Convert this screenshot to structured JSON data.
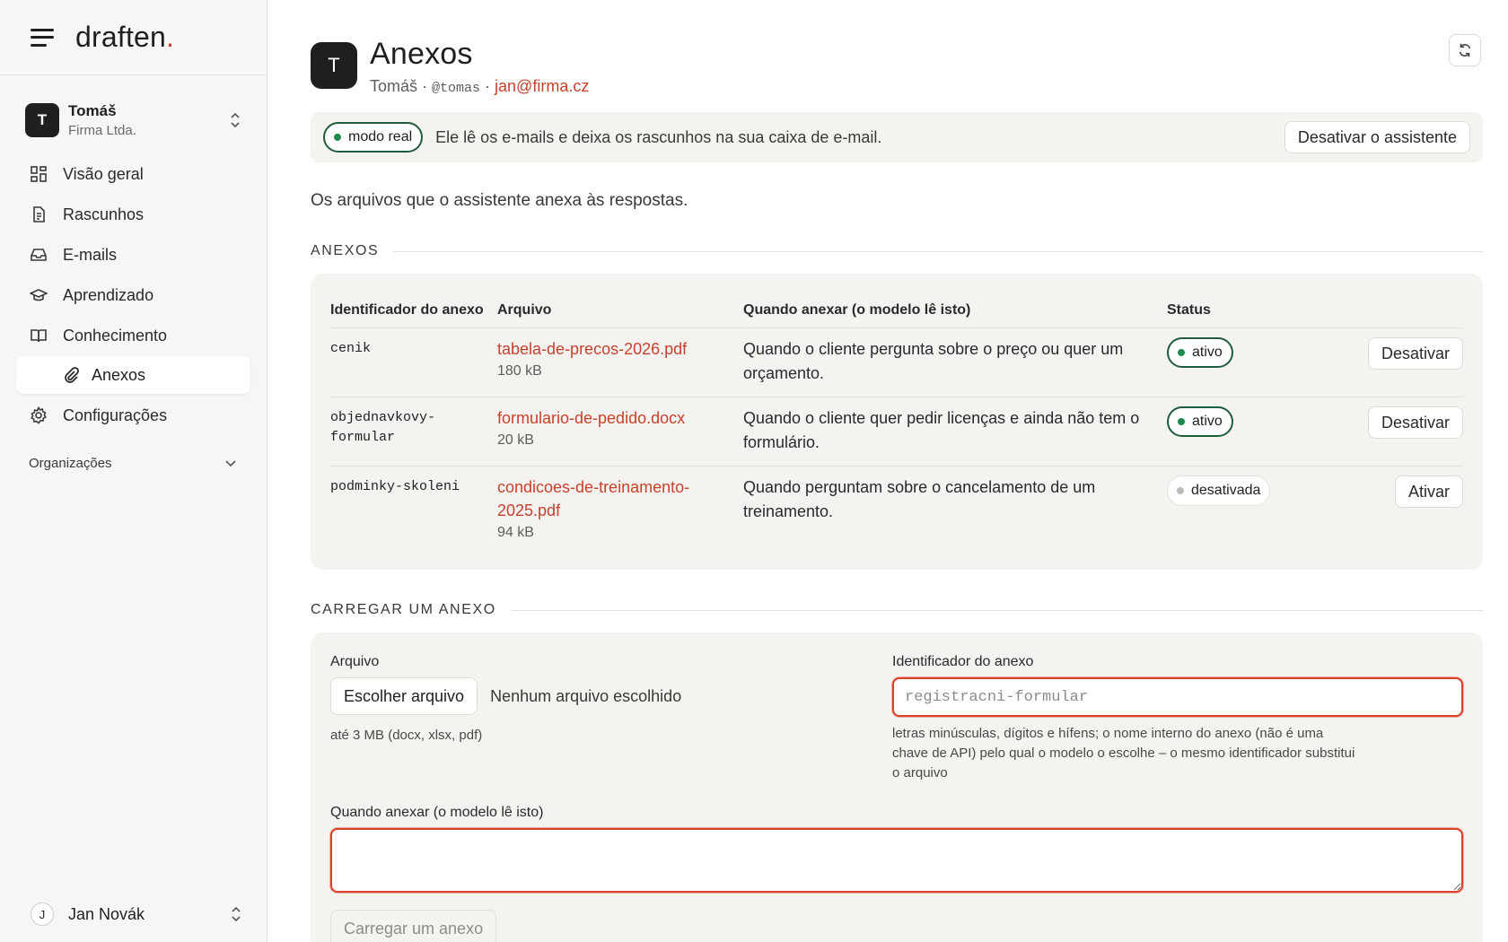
{
  "app": {
    "logo_text": "draften",
    "logo_dot": ".",
    "accent_color": "#c8412b"
  },
  "sidebar": {
    "account": {
      "initial": "T",
      "name": "Tomáš",
      "org": "Firma Ltda."
    },
    "items": [
      {
        "label": "Visão geral",
        "icon": "dashboard-icon"
      },
      {
        "label": "Rascunhos",
        "icon": "document-icon"
      },
      {
        "label": "E-mails",
        "icon": "inbox-icon"
      },
      {
        "label": "Aprendizado",
        "icon": "graduation-cap-icon"
      },
      {
        "label": "Conhecimento",
        "icon": "book-icon"
      }
    ],
    "sub_item": {
      "label": "Anexos",
      "icon": "paperclip-icon"
    },
    "settings": {
      "label": "Configurações",
      "icon": "gear-icon"
    },
    "organizations_label": "Organizações",
    "user": {
      "initial": "J",
      "name": "Jan Novák"
    }
  },
  "header": {
    "avatar_initial": "T",
    "title": "Anexos",
    "user_name": "Tomáš",
    "sep1": " · ",
    "handle": "@tomas",
    "sep2": " · ",
    "email": "jan@firma.cz"
  },
  "banner": {
    "mode_label": "modo real",
    "text": "Ele lê os e-mails e deixa os rascunhos na sua caixa de e-mail.",
    "deactivate_button": "Desativar o assistente"
  },
  "intro": "Os arquivos que o assistente anexa às respostas.",
  "attachments_section": {
    "label": "ANEXOS",
    "columns": [
      "Identificador do anexo",
      "Arquivo",
      "Quando anexar (o modelo lê isto)",
      "Status",
      ""
    ],
    "rows": [
      {
        "identifier": "cenik",
        "file": "tabela-de-precos-2026.pdf",
        "size": "180 kB",
        "when": "Quando o cliente pergunta sobre o preço ou quer um orçamento.",
        "status": "ativo",
        "action": "Desativar"
      },
      {
        "identifier": "objednavkovy-formular",
        "file": "formulario-de-pedido.docx",
        "size": "20 kB",
        "when": "Quando o cliente quer pedir licenças e ainda não tem o formulário.",
        "status": "ativo",
        "action": "Desativar"
      },
      {
        "identifier": "podminky-skoleni",
        "file": "condicoes-de-treinamento-2025.pdf",
        "size": "94 kB",
        "when": "Quando perguntam sobre o cancelamento de um treinamento.",
        "status": "desativada",
        "action": "Ativar"
      }
    ]
  },
  "upload_section": {
    "label": "CARREGAR UM ANEXO",
    "file_label": "Arquivo",
    "choose_button": "Escolher arquivo",
    "no_file": "Nenhum arquivo escolhido",
    "file_hint": "até 3 MB (docx, xlsx, pdf)",
    "identifier_label": "Identificador do anexo",
    "identifier_placeholder": "registracni-formular",
    "identifier_value": "",
    "identifier_hint": "letras minúsculas, dígitos e hífens; o nome interno do anexo (não é uma chave de API) pelo qual o modelo o escolhe – o mesmo identificador substitui o arquivo",
    "when_label": "Quando anexar (o modelo lê isto)",
    "when_value": "",
    "submit_button": "Carregar um anexo"
  }
}
